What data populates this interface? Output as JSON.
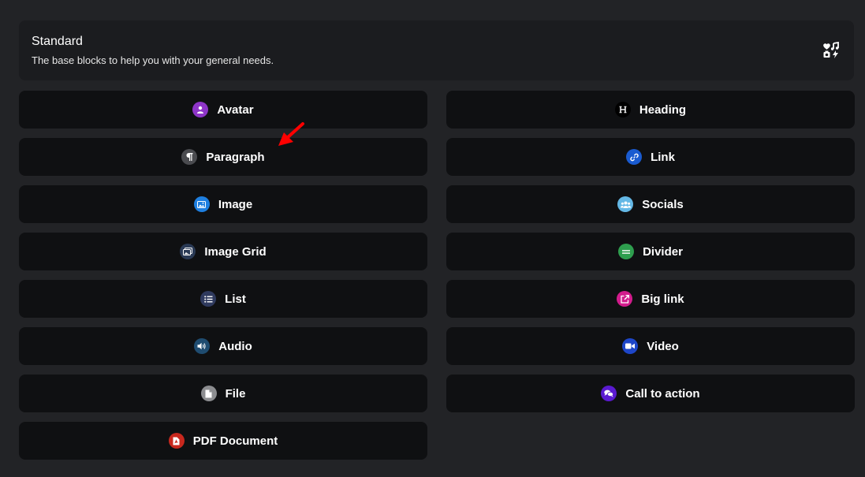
{
  "section": {
    "title": "Standard",
    "subtitle": "The base blocks to help you with your general needs.",
    "icon": "shapes-icon"
  },
  "blocks_left": [
    {
      "label": "Avatar",
      "icon": "avatar-icon",
      "color": "#8e35c8"
    },
    {
      "label": "Paragraph",
      "icon": "paragraph-icon",
      "color": "#4a4b4f"
    },
    {
      "label": "Image",
      "icon": "image-icon",
      "color": "#1e7fe0"
    },
    {
      "label": "Image Grid",
      "icon": "image-grid-icon",
      "color": "#2a3a55"
    },
    {
      "label": "List",
      "icon": "list-icon",
      "color": "#2f3a5e"
    },
    {
      "label": "Audio",
      "icon": "audio-icon",
      "color": "#1f4c70"
    },
    {
      "label": "File",
      "icon": "file-icon",
      "color": "#8c8d90"
    },
    {
      "label": "PDF Document",
      "icon": "pdf-icon",
      "color": "#c8281e"
    }
  ],
  "blocks_right": [
    {
      "label": "Heading",
      "icon": "heading-icon",
      "color": "#000000"
    },
    {
      "label": "Link",
      "icon": "link-icon",
      "color": "#1a5bd0"
    },
    {
      "label": "Socials",
      "icon": "socials-icon",
      "color": "#64b8e6"
    },
    {
      "label": "Divider",
      "icon": "divider-icon",
      "color": "#2e9e4e"
    },
    {
      "label": "Big link",
      "icon": "big-link-icon",
      "color": "#d21c8c"
    },
    {
      "label": "Video",
      "icon": "video-icon",
      "color": "#1e46c8"
    },
    {
      "label": "Call to action",
      "icon": "chat-icon",
      "color": "#5a1ad0"
    }
  ],
  "annotation": {
    "arrow_color": "#ff0000"
  }
}
